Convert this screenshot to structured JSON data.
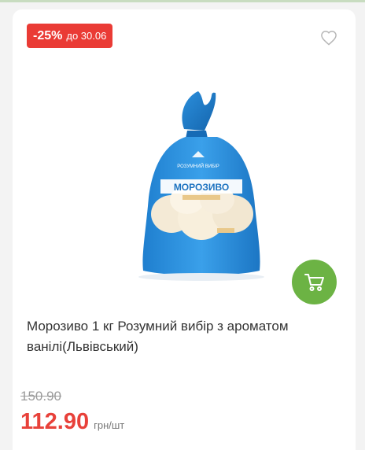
{
  "colors": {
    "badge": "#ea3b35",
    "cart": "#6cb344",
    "price": "#e8413a",
    "old_price": "#9b9b9b"
  },
  "badge": {
    "discount": "-25%",
    "until": "до 30.06"
  },
  "product": {
    "title": "Морозиво 1 кг Розумний вибір з ароматом ванілі(Львівський)",
    "package_label": "МОРОЗИВО",
    "brand_label": "РОЗУМНИЙ ВИБІР",
    "old_price": "150.90",
    "price": "112.90",
    "unit": "грн/шт"
  },
  "icons": {
    "favorite": "heart-icon",
    "cart": "cart-icon"
  }
}
